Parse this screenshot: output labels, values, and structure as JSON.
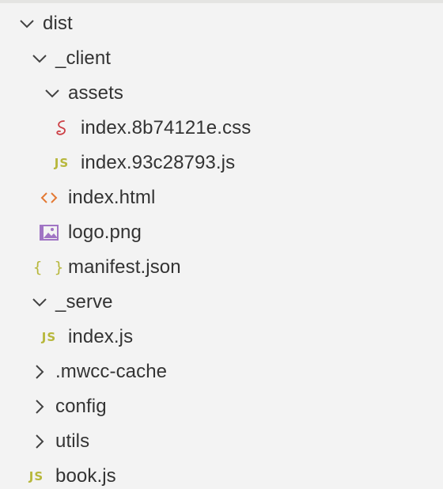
{
  "tree": {
    "dist": {
      "label": "dist",
      "expanded": true
    },
    "client": {
      "label": "_client",
      "expanded": true
    },
    "assets": {
      "label": "assets",
      "expanded": true
    },
    "css_file": {
      "label": "index.8b74121e.css",
      "icon": "css-icon"
    },
    "js_file_assets": {
      "label": "index.93c28793.js",
      "icon": "js-icon",
      "icon_text": "JS"
    },
    "html_file": {
      "label": "index.html",
      "icon": "html-icon"
    },
    "logo_file": {
      "label": "logo.png",
      "icon": "image-icon"
    },
    "manifest_file": {
      "label": "manifest.json",
      "icon": "json-icon",
      "icon_text": "{ }"
    },
    "serve": {
      "label": "_serve",
      "expanded": true
    },
    "serve_index": {
      "label": "index.js",
      "icon": "js-icon",
      "icon_text": "JS"
    },
    "mwcc_cache": {
      "label": ".mwcc-cache",
      "expanded": false
    },
    "config": {
      "label": "config",
      "expanded": false
    },
    "utils": {
      "label": "utils",
      "expanded": false
    },
    "book_file": {
      "label": "book.js",
      "icon": "js-icon",
      "icon_text": "JS"
    }
  },
  "colors": {
    "background": "#f3f3f3",
    "text": "#333333",
    "chevron": "#424242",
    "js_icon": "#b7b73b",
    "html_icon": "#e37933",
    "css_icon": "#cc3e44",
    "image_icon": "#a074c4"
  }
}
